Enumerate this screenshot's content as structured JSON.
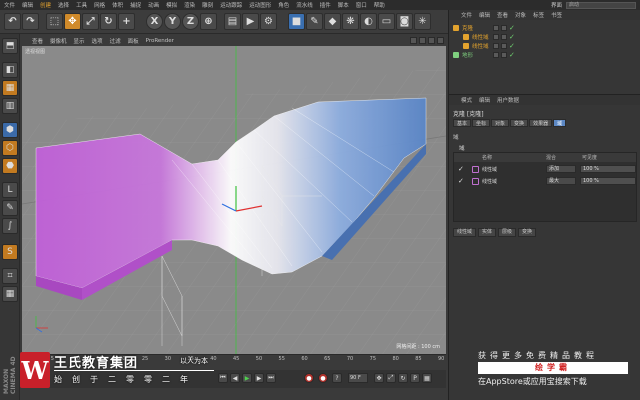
{
  "menubar": {
    "items": [
      "文件",
      "编辑",
      "创建",
      "选择",
      "工具",
      "网格",
      "体积",
      "捕捉",
      "动画",
      "模拟",
      "渲染",
      "雕刻",
      "运动跟踪",
      "运动图形",
      "角色",
      "流水线",
      "插件",
      "脚本",
      "窗口",
      "帮助"
    ],
    "active_index": 2,
    "layout_label": "界面",
    "layout_value": "启动"
  },
  "toolbar": {
    "x_label": "X",
    "y_label": "Y",
    "z_label": "Z"
  },
  "viewport": {
    "menu": [
      "查看",
      "摄像机",
      "显示",
      "选项",
      "过滤",
      "面板",
      "ProRender"
    ],
    "label": "透视视图",
    "grid_distance": "网格间距 : 100 cm"
  },
  "object_manager": {
    "menu": [
      "文件",
      "编辑",
      "查看",
      "对象",
      "标签",
      "书签"
    ],
    "objects": [
      {
        "name": "克隆",
        "color": "#e3a32e"
      },
      {
        "name": "线性域",
        "color": "#e3a32e"
      },
      {
        "name": "线性域",
        "color": "#e3a32e"
      },
      {
        "name": "地形",
        "color": "#7fd07f"
      }
    ]
  },
  "attribute_manager": {
    "menu": [
      "模式",
      "编辑",
      "用户数据"
    ],
    "title": "克隆 [克隆]",
    "tabs": [
      "基本",
      "坐标",
      "对象",
      "变换",
      "效果器",
      "域"
    ],
    "selected_tab": 5,
    "section": "域",
    "field_label": "域",
    "columns": [
      "名称",
      "混合",
      "可见度"
    ],
    "rows": [
      {
        "name": "线性域",
        "mode": "添加",
        "visibility": "100 %"
      },
      {
        "name": "线性域",
        "mode": "最大",
        "visibility": "100 %"
      }
    ],
    "buttons": [
      "线性域",
      "实体",
      "层级",
      "变换"
    ]
  },
  "timeline": {
    "ticks": [
      "0",
      "5",
      "10",
      "15",
      "20",
      "25",
      "30",
      "35",
      "40",
      "45",
      "50",
      "55",
      "60",
      "65",
      "70",
      "75",
      "80",
      "85",
      "90"
    ],
    "start": "0 F",
    "end": "90 F",
    "current": "0 F"
  },
  "watermark": {
    "logo": "W",
    "company": "王氏教育集团",
    "motto": "以人为本",
    "founded": "始创于二零零二年",
    "promo_line1": "获得更多免费精品教程",
    "promo_brand": "绘学霸",
    "promo_line3": "在AppStore或应用宝搜索下载",
    "software": "MAXON CINEMA 4D"
  },
  "colors": {
    "accent": "#e3a32e",
    "selected_tab": "#5c88c4",
    "shape_purple": "#c060d8",
    "shape_blue": "#5a86c8",
    "logo_red": "#c8202a"
  }
}
